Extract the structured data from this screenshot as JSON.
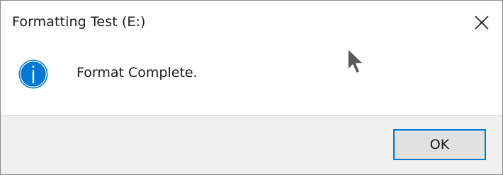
{
  "window": {
    "title": "Formatting Test (E:)"
  },
  "message": {
    "icon": "info-icon",
    "text": "Format Complete."
  },
  "buttons": {
    "ok_label": "OK"
  },
  "colors": {
    "info_icon": "#0078d7",
    "ok_border": "#0078d7",
    "footer_bg": "#f0f0f0",
    "button_bg": "#e1e1e1"
  }
}
